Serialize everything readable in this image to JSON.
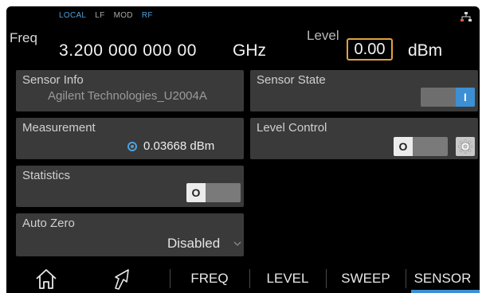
{
  "status": {
    "local": "LOCAL",
    "lf": "LF",
    "mod": "MOD",
    "rf": "RF",
    "network_icon": "network-icon"
  },
  "header": {
    "freq_label": "Freq",
    "freq_value": "3.200 000 000 00",
    "freq_unit": "GHz",
    "level_label": "Level",
    "level_value": "0.00",
    "level_unit": "dBm"
  },
  "panels": {
    "sensor_info": {
      "title": "Sensor Info",
      "value": "Agilent Technologies_U2004A"
    },
    "sensor_state": {
      "title": "Sensor State",
      "toggle_label": "I",
      "state": "on"
    },
    "measurement": {
      "title": "Measurement",
      "value": "0.03668 dBm"
    },
    "level_control": {
      "title": "Level Control",
      "toggle_label": "O",
      "state": "off",
      "settings_icon": "gear-icon"
    },
    "statistics": {
      "title": "Statistics",
      "toggle_label": "O",
      "state": "off"
    },
    "auto_zero": {
      "title": "Auto Zero",
      "value": "Disabled"
    }
  },
  "bottom_bar": {
    "home_icon": "home-icon",
    "arrow_icon": "arrow-up-right-icon",
    "freq": "FREQ",
    "level": "LEVEL",
    "sweep": "SWEEP",
    "sensor": "SENSOR",
    "active": "SENSOR"
  },
  "colors": {
    "accent": "#3d8fd4",
    "level_box_border": "#e1a23a",
    "panel_bg": "#3a3a3a",
    "screen_bg": "#000000"
  }
}
